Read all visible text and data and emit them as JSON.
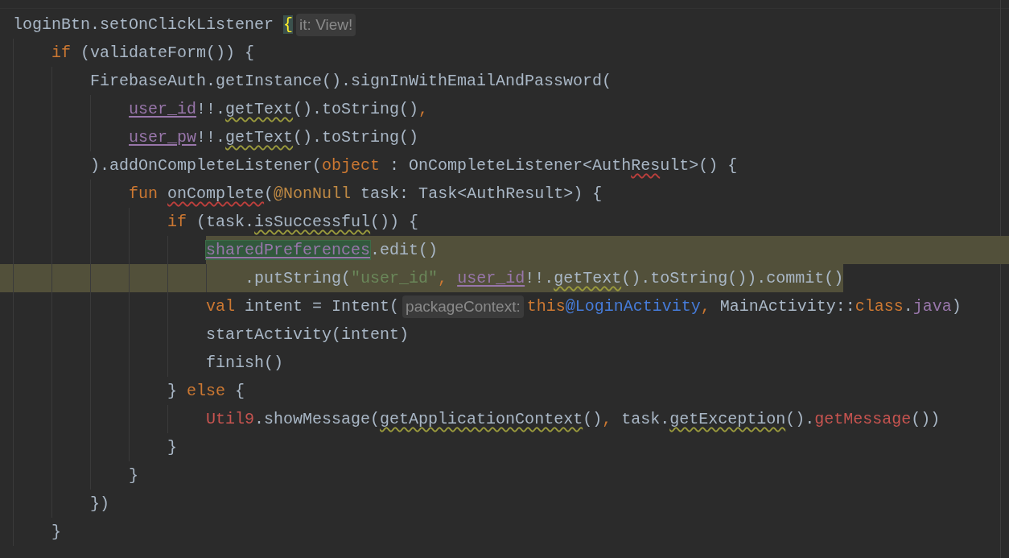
{
  "editor": {
    "lines": [
      {
        "selected": false,
        "segments": [
          {
            "kind": "code",
            "tokens": [
              {
                "text": "loginBtn.setOnClickListener ",
                "kind": "plain"
              },
              {
                "text": "{",
                "kind": "brace"
              }
            ]
          },
          {
            "kind": "hint",
            "text": "it: View!"
          }
        ]
      },
      {
        "selected": false,
        "segments": [
          {
            "kind": "code",
            "tokens": [
              {
                "text": "    if",
                "kind": "keyword"
              },
              {
                "text": " (validateForm()) {",
                "kind": "plain"
              }
            ]
          }
        ]
      },
      {
        "selected": false,
        "segments": [
          {
            "kind": "code",
            "tokens": [
              {
                "text": "        FirebaseAuth.getInstance().signInWithEmailAndPassword(",
                "kind": "plain"
              }
            ]
          }
        ]
      },
      {
        "selected": false,
        "segments": [
          {
            "kind": "code",
            "tokens": [
              {
                "text": "            user_id",
                "kind": "field"
              },
              {
                "text": "!!.",
                "kind": "plain"
              },
              {
                "text": "getText",
                "kind": "warn_call"
              },
              {
                "text": "().toString()",
                "kind": "plain"
              },
              {
                "text": ",",
                "kind": "keyword"
              }
            ]
          }
        ]
      },
      {
        "selected": false,
        "segments": [
          {
            "kind": "code",
            "tokens": [
              {
                "text": "            user_pw",
                "kind": "field"
              },
              {
                "text": "!!.",
                "kind": "plain"
              },
              {
                "text": "getText",
                "kind": "warn_call"
              },
              {
                "text": "().toString()",
                "kind": "plain"
              }
            ]
          }
        ]
      },
      {
        "selected": false,
        "segments": [
          {
            "kind": "code",
            "tokens": [
              {
                "text": "        ).addOnCompleteListener(",
                "kind": "plain"
              },
              {
                "text": "object",
                "kind": "keyword"
              },
              {
                "text": " : OnCompleteListener<Auth",
                "kind": "plain"
              },
              {
                "text": "Res",
                "kind": "error_call"
              },
              {
                "text": "ult>() {",
                "kind": "plain"
              }
            ]
          }
        ]
      },
      {
        "selected": false,
        "segments": [
          {
            "kind": "code",
            "tokens": [
              {
                "text": "            fun ",
                "kind": "keyword"
              },
              {
                "text": "onComplete",
                "kind": "error_call"
              },
              {
                "text": "(",
                "kind": "plain"
              },
              {
                "text": "@NonNull",
                "kind": "annotation"
              },
              {
                "text": " task: Task<AuthResult>) {",
                "kind": "plain"
              }
            ]
          }
        ]
      },
      {
        "selected": false,
        "segments": [
          {
            "kind": "code",
            "tokens": [
              {
                "text": "                if",
                "kind": "keyword"
              },
              {
                "text": " (task.",
                "kind": "plain"
              },
              {
                "text": "isSuccessful",
                "kind": "warn_call"
              },
              {
                "text": "()) {",
                "kind": "plain"
              }
            ]
          }
        ]
      },
      {
        "selected": true,
        "segments": [
          {
            "kind": "code",
            "tokens": [
              {
                "text": "                    sharedPreferences",
                "kind": "match"
              },
              {
                "text": ".edit()",
                "kind": "plain"
              }
            ]
          }
        ]
      },
      {
        "selected": true,
        "segments": [
          {
            "kind": "code",
            "tokens": [
              {
                "text": "                        .putString(",
                "kind": "plain"
              },
              {
                "text": "\"user_id\"",
                "kind": "string"
              },
              {
                "text": ", ",
                "kind": "keyword"
              },
              {
                "text": "user_id",
                "kind": "field"
              },
              {
                "text": "!!.",
                "kind": "plain"
              },
              {
                "text": "getText",
                "kind": "warn_call"
              },
              {
                "text": "().toString()).commit()",
                "kind": "plain"
              }
            ]
          }
        ]
      },
      {
        "selected": false,
        "segments": [
          {
            "kind": "code",
            "tokens": [
              {
                "text": "                    val",
                "kind": "keyword"
              },
              {
                "text": " intent = Intent(",
                "kind": "plain"
              }
            ]
          },
          {
            "kind": "hint",
            "text": "packageContext:"
          },
          {
            "kind": "code",
            "tokens": [
              {
                "text": "this",
                "kind": "keyword"
              },
              {
                "text": "@LoginActivity",
                "kind": "label"
              },
              {
                "text": ",",
                "kind": "keyword"
              },
              {
                "text": " MainActivity::",
                "kind": "plain"
              },
              {
                "text": "class",
                "kind": "keyword"
              },
              {
                "text": ".",
                "kind": "plain"
              },
              {
                "text": "java",
                "kind": "member"
              },
              {
                "text": ")",
                "kind": "plain"
              }
            ]
          }
        ]
      },
      {
        "selected": false,
        "segments": [
          {
            "kind": "code",
            "tokens": [
              {
                "text": "                    startActivity(intent)",
                "kind": "plain"
              }
            ]
          }
        ]
      },
      {
        "selected": false,
        "segments": [
          {
            "kind": "code",
            "tokens": [
              {
                "text": "                    finish()",
                "kind": "plain"
              }
            ]
          }
        ]
      },
      {
        "selected": false,
        "segments": [
          {
            "kind": "code",
            "tokens": [
              {
                "text": "                } ",
                "kind": "plain"
              },
              {
                "text": "else",
                "kind": "keyword"
              },
              {
                "text": " {",
                "kind": "plain"
              }
            ]
          }
        ]
      },
      {
        "selected": false,
        "segments": [
          {
            "kind": "code",
            "tokens": [
              {
                "text": "                    Util9",
                "kind": "error"
              },
              {
                "text": ".showMessage(",
                "kind": "plain"
              },
              {
                "text": "getApplicationContext",
                "kind": "warn_call"
              },
              {
                "text": "()",
                "kind": "plain"
              },
              {
                "text": ",",
                "kind": "keyword"
              },
              {
                "text": " task.",
                "kind": "plain"
              },
              {
                "text": "getException",
                "kind": "warn_call"
              },
              {
                "text": "().",
                "kind": "plain"
              },
              {
                "text": "getMessage",
                "kind": "error"
              },
              {
                "text": "())",
                "kind": "plain"
              }
            ]
          }
        ]
      },
      {
        "selected": false,
        "segments": [
          {
            "kind": "code",
            "tokens": [
              {
                "text": "                }",
                "kind": "plain"
              }
            ]
          }
        ]
      },
      {
        "selected": false,
        "segments": [
          {
            "kind": "code",
            "tokens": [
              {
                "text": "            }",
                "kind": "plain"
              }
            ]
          }
        ]
      },
      {
        "selected": false,
        "segments": [
          {
            "kind": "code",
            "tokens": [
              {
                "text": "        })",
                "kind": "plain"
              }
            ]
          }
        ]
      },
      {
        "selected": false,
        "segments": [
          {
            "kind": "code",
            "tokens": [
              {
                "text": "    }",
                "kind": "plain"
              }
            ]
          }
        ]
      }
    ]
  }
}
